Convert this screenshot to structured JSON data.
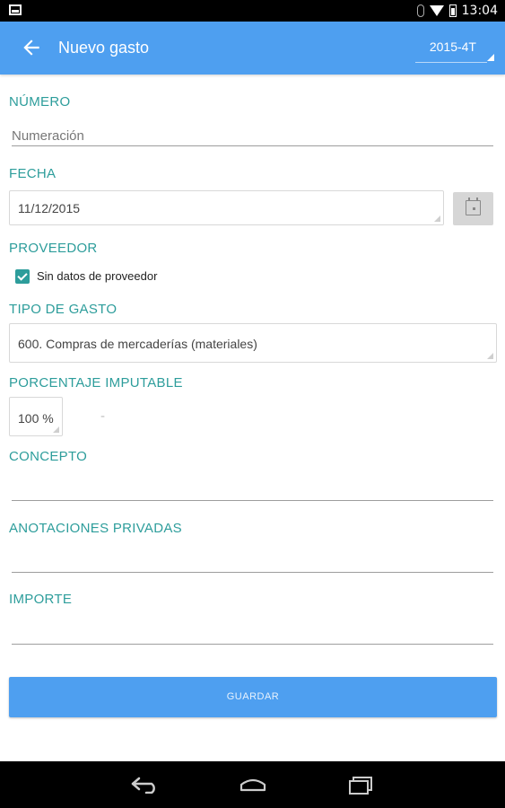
{
  "status_bar": {
    "time": "13:04"
  },
  "appbar": {
    "title": "Nuevo gasto",
    "period": "2015-4T"
  },
  "form": {
    "numero_label": "NÚMERO",
    "numero_placeholder": "Numeración",
    "fecha_label": "FECHA",
    "fecha_value": "11/12/2015",
    "proveedor_label": "PROVEEDOR",
    "proveedor_checkbox_label": "Sin datos de proveedor",
    "proveedor_checkbox_checked": true,
    "tipo_label": "TIPO DE GASTO",
    "tipo_value": "600. Compras de mercaderías (materiales)",
    "porcentaje_label": "PORCENTAJE IMPUTABLE",
    "porcentaje_value": "100 %",
    "porcentaje_dash": "-",
    "concepto_label": "CONCEPTO",
    "anotaciones_label": "ANOTACIONES PRIVADAS",
    "importe_label": "IMPORTE"
  },
  "actions": {
    "save_label": "GUARDAR"
  },
  "colors": {
    "primary": "#4e9ff0",
    "accent": "#2d9d9b"
  },
  "icons": [
    "back-arrow-icon",
    "calendar-icon",
    "checkbox-checked-icon",
    "nav-back-icon",
    "nav-home-icon",
    "nav-recents-icon"
  ]
}
